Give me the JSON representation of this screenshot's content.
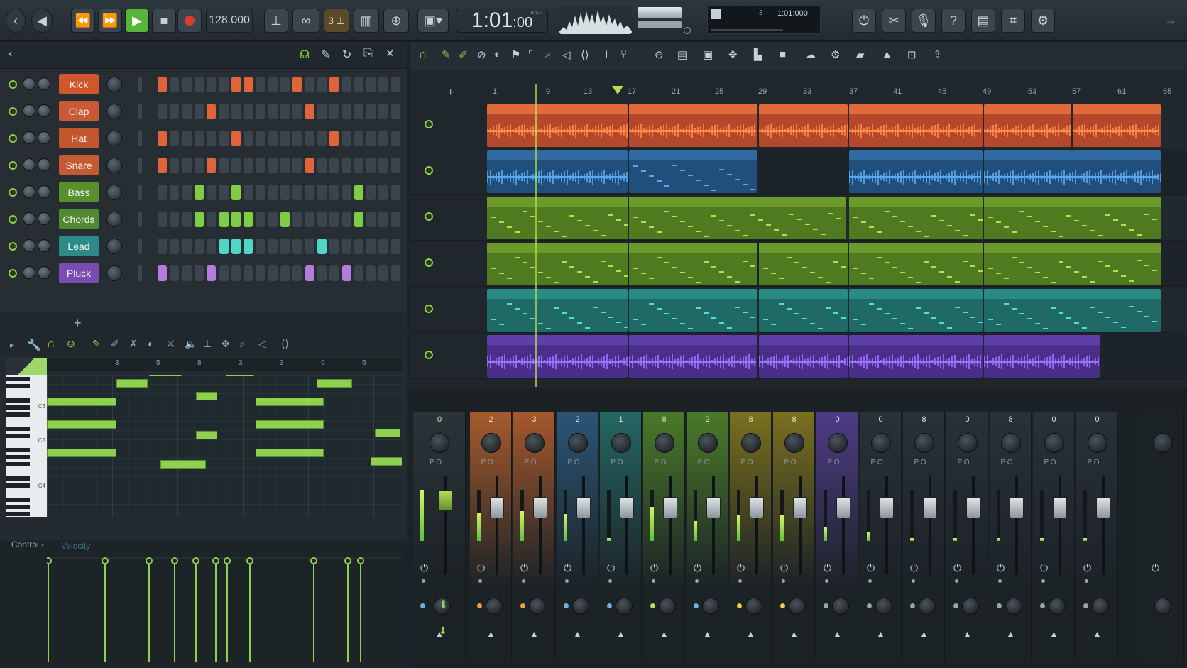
{
  "transport": {
    "tempo": "128.000",
    "time_main": "1:01",
    "time_sub": "00",
    "time_unit": "B:S:T",
    "pattern_display": "3 ⊥",
    "monitor_pos": "1:01:000",
    "monitor_label": "3"
  },
  "channels": [
    {
      "name": "Kick",
      "color": "#d0562c",
      "pattern": [
        1,
        0,
        0,
        0,
        0,
        0,
        1,
        1,
        0,
        0,
        0,
        1,
        0,
        0,
        1,
        0,
        0,
        0,
        0,
        0
      ]
    },
    {
      "name": "Clap",
      "color": "#c95a34",
      "pattern": [
        0,
        0,
        0,
        0,
        1,
        0,
        0,
        0,
        0,
        0,
        0,
        0,
        1,
        0,
        0,
        0,
        0,
        0,
        0,
        0
      ]
    },
    {
      "name": "Hat",
      "color": "#c0552e",
      "pattern": [
        1,
        0,
        0,
        0,
        0,
        0,
        1,
        0,
        0,
        0,
        0,
        0,
        0,
        0,
        1,
        0,
        0,
        0,
        0,
        0
      ]
    },
    {
      "name": "Snare",
      "color": "#c35a31",
      "pattern": [
        1,
        0,
        0,
        0,
        1,
        0,
        0,
        0,
        0,
        0,
        0,
        0,
        1,
        0,
        0,
        0,
        0,
        0,
        0,
        0
      ]
    },
    {
      "name": "Bass",
      "color": "#5a8f2d",
      "pattern": [
        0,
        0,
        0,
        1,
        0,
        0,
        1,
        0,
        0,
        0,
        0,
        0,
        0,
        0,
        0,
        0,
        1,
        0,
        0,
        0
      ]
    },
    {
      "name": "Chords",
      "color": "#4f8a31",
      "pattern": [
        0,
        0,
        0,
        1,
        0,
        1,
        1,
        1,
        0,
        0,
        1,
        0,
        0,
        0,
        0,
        0,
        1,
        0,
        0,
        0
      ]
    },
    {
      "name": "Lead",
      "color": "#2e8a86",
      "pattern": [
        0,
        0,
        0,
        0,
        0,
        1,
        1,
        1,
        0,
        0,
        0,
        0,
        0,
        1,
        0,
        0,
        0,
        0,
        0,
        0
      ]
    },
    {
      "name": "Pluck",
      "color": "#7a4bb0",
      "pattern": [
        1,
        0,
        0,
        0,
        1,
        0,
        0,
        0,
        0,
        0,
        0,
        0,
        1,
        0,
        0,
        1,
        0,
        0,
        0,
        0
      ]
    }
  ],
  "add_channel_label": "+",
  "pianoroll": {
    "ruler": [
      "3",
      "5",
      "8",
      "3",
      "3",
      "9",
      "5"
    ],
    "key_labels": [
      "C6",
      "C5",
      "C4"
    ],
    "control_label": "Control -",
    "velocity_label": "Velocity"
  },
  "playlist": {
    "ruler": [
      "1",
      "9",
      "13",
      "17",
      "21",
      "25",
      "29",
      "33",
      "37",
      "41",
      "45",
      "49",
      "53",
      "57",
      "61",
      "65"
    ],
    "add_track": "+"
  },
  "mixer": {
    "strips": [
      {
        "num": "0",
        "color": "#2a3338"
      },
      {
        "num": "2",
        "color": "#a65a2c"
      },
      {
        "num": "3",
        "color": "#a6582c"
      },
      {
        "num": "2",
        "color": "#2c5576"
      },
      {
        "num": "1",
        "color": "#246763"
      },
      {
        "num": "8",
        "color": "#4a7a28"
      },
      {
        "num": "2",
        "color": "#4b7b29"
      },
      {
        "num": "8",
        "color": "#7a6f1e"
      },
      {
        "num": "8",
        "color": "#7a701f"
      },
      {
        "num": "0",
        "color": "#4e3b86"
      },
      {
        "num": "0",
        "color": "#283139"
      },
      {
        "num": "8",
        "color": "#283139"
      },
      {
        "num": "0",
        "color": "#283139"
      },
      {
        "num": "8",
        "color": "#283139"
      },
      {
        "num": "0",
        "color": "#283139"
      },
      {
        "num": "0",
        "color": "#283139"
      }
    ]
  },
  "colors": {
    "accent_green": "#8fd14f",
    "play": "#57b63a",
    "record": "#e03a2f"
  }
}
